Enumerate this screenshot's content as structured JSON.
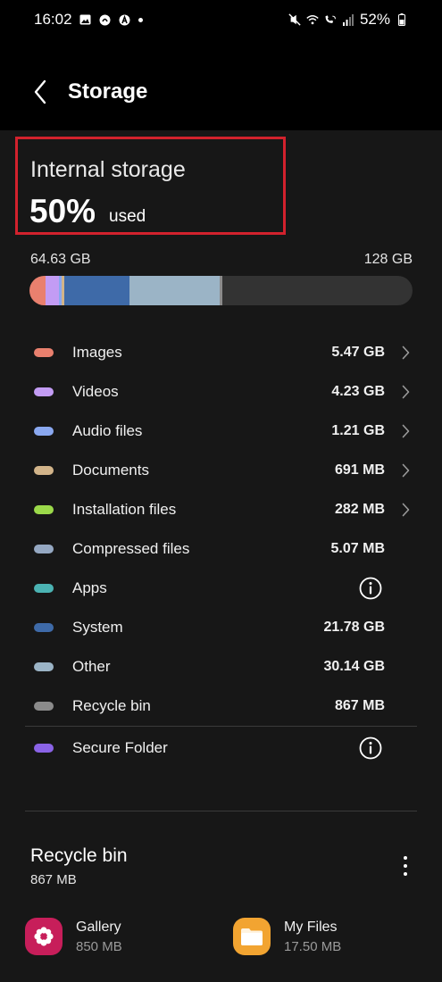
{
  "status_bar": {
    "time": "16:02",
    "battery": "52%"
  },
  "header": {
    "title": "Storage"
  },
  "internal": {
    "title": "Internal storage",
    "percent": "50%",
    "used_label": "used",
    "used_size": "64.63 GB",
    "total_size": "128 GB"
  },
  "storage_bar": {
    "segments": [
      {
        "category": "Images",
        "color": "#e9806e",
        "fraction": 0.043
      },
      {
        "category": "Videos",
        "color": "#c39cf4",
        "fraction": 0.033
      },
      {
        "category": "Audio files",
        "color": "#8aa8f0",
        "fraction": 0.009
      },
      {
        "category": "Documents",
        "color": "#d2b48a",
        "fraction": 0.005
      },
      {
        "category": "Installation files",
        "color": "#9bd94a",
        "fraction": 0.002
      },
      {
        "category": "System",
        "color": "#3e6aa8",
        "fraction": 0.17
      },
      {
        "category": "Other",
        "color": "#9bb4c6",
        "fraction": 0.235
      },
      {
        "category": "Recycle bin",
        "color": "#8b8b8b",
        "fraction": 0.007
      }
    ]
  },
  "categories": [
    {
      "name": "Images",
      "size": "5.47 GB",
      "color": "#e9806e",
      "action": "chevron"
    },
    {
      "name": "Videos",
      "size": "4.23 GB",
      "color": "#c39cf4",
      "action": "chevron"
    },
    {
      "name": "Audio files",
      "size": "1.21 GB",
      "color": "#8aa8f0",
      "action": "chevron"
    },
    {
      "name": "Documents",
      "size": "691 MB",
      "color": "#d2b48a",
      "action": "chevron"
    },
    {
      "name": "Installation files",
      "size": "282 MB",
      "color": "#9bd94a",
      "action": "chevron"
    },
    {
      "name": "Compressed files",
      "size": "5.07 MB",
      "color": "#95a8c2",
      "action": "none"
    },
    {
      "name": "Apps",
      "size": "",
      "color": "#4bb3b3",
      "action": "info"
    },
    {
      "name": "System",
      "size": "21.78 GB",
      "color": "#3e6aa8",
      "action": "none"
    },
    {
      "name": "Other",
      "size": "30.14 GB",
      "color": "#9bb4c6",
      "action": "none"
    },
    {
      "name": "Recycle bin",
      "size": "867 MB",
      "color": "#8b8b8b",
      "action": "none"
    },
    {
      "name": "Secure Folder",
      "size": "",
      "color": "#8a63e6",
      "action": "info"
    }
  ],
  "recycle_bin": {
    "title": "Recycle bin",
    "size": "867 MB",
    "apps": [
      {
        "name": "Gallery",
        "size": "850 MB",
        "icon": "gallery-flower-icon",
        "color": "#c71e5a"
      },
      {
        "name": "My Files",
        "size": "17.50 MB",
        "icon": "folder-icon",
        "color": "#f2a431"
      }
    ]
  }
}
